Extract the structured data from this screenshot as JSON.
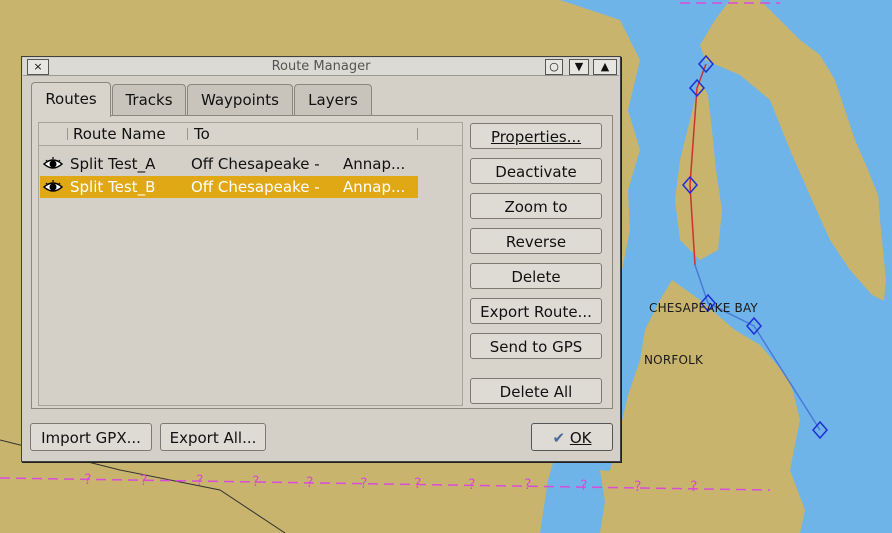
{
  "map": {
    "labels": {
      "chesapeake_bay": "CHESAPEAKE BAY",
      "norfolk": "NORFOLK"
    },
    "colors": {
      "land": "#c8b46c",
      "water": "#6eb4e8",
      "route_active": "#d03030",
      "route_inactive": "#4a7ad8",
      "boundary": "#d84cd8"
    },
    "boundary_marker": "?"
  },
  "dialog": {
    "title": "Route Manager",
    "title_buttons": [
      "×",
      "○",
      "▼",
      "▲"
    ],
    "tabs": [
      "Routes",
      "Tracks",
      "Waypoints",
      "Layers"
    ],
    "active_tab": "Routes",
    "list": {
      "headers": {
        "name": "Route Name",
        "to": "To"
      },
      "rows": [
        {
          "name": "Split Test_A",
          "to": "Off Chesapeake -",
          "to2": "Annap...",
          "visible_icon": "eye-icon",
          "selected": false
        },
        {
          "name": "Split Test_B",
          "to": "Off Chesapeake -",
          "to2": "Annap...",
          "visible_icon": "eye-icon",
          "selected": true
        }
      ]
    },
    "buttons": {
      "properties": "Properties...",
      "deactivate": "Deactivate",
      "zoom_to": "Zoom to",
      "reverse": "Reverse",
      "delete": "Delete",
      "export_route": "Export Route...",
      "send_to_gps": "Send to GPS",
      "delete_all": "Delete All"
    },
    "bottom": {
      "import_gpx": "Import GPX...",
      "export_all": "Export All...",
      "ok": "OK",
      "ok_icon": "check-icon"
    }
  }
}
